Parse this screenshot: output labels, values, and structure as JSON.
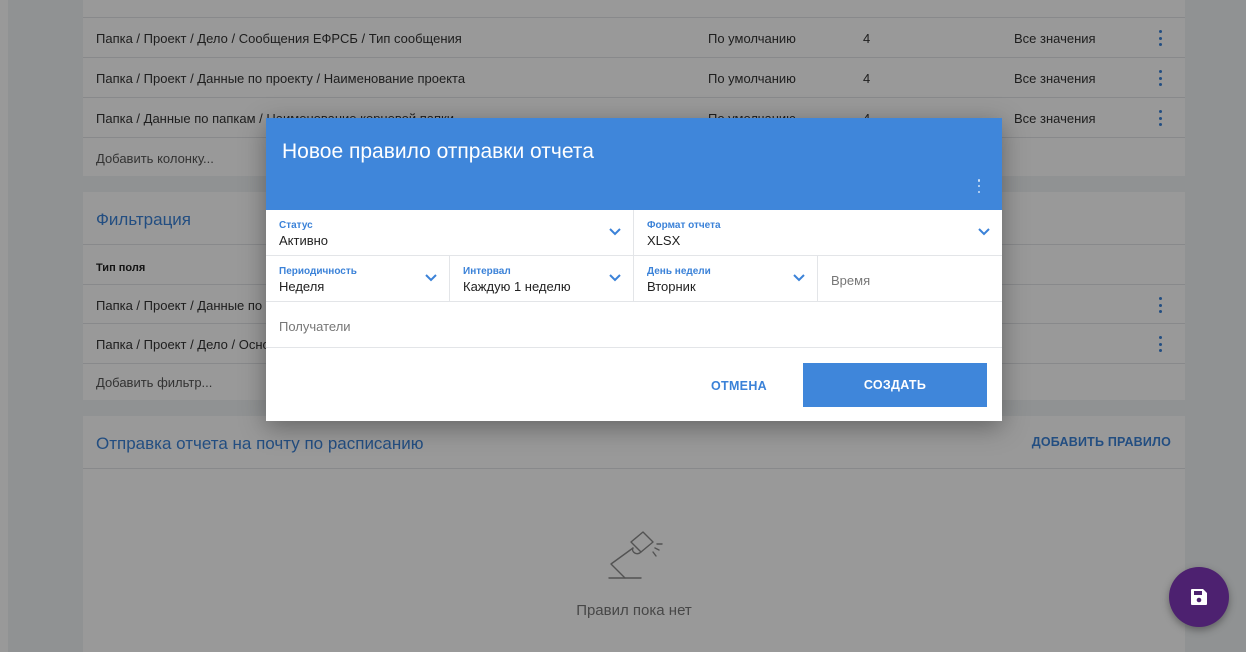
{
  "colors": {
    "accent": "#3f86da",
    "link": "#3b82d8",
    "fab": "#4d2170",
    "overlay": "rgba(0,0,0,0.4)"
  },
  "columns_table": {
    "rows": [
      {
        "path": "Папка / Проект / Дело / Сообщения ЕФРСБ / Тип сообщения",
        "sort": "По умолчанию",
        "width": "4",
        "values": "Все значения"
      },
      {
        "path": "Папка / Проект / Данные по проекту / Наименование проекта",
        "sort": "По умолчанию",
        "width": "4",
        "values": "Все значения"
      },
      {
        "path": "Папка / Данные по папкам / Наименование корневой папки",
        "sort": "По умолчанию",
        "width": "4",
        "values": "Все значения"
      }
    ],
    "add_column_label": "Добавить колонку..."
  },
  "filtering": {
    "title": "Фильтрация",
    "field_type_header": "Тип поля",
    "rows": [
      {
        "path": "Папка / Проект / Данные по"
      },
      {
        "path": "Папка / Проект / Дело / Осно"
      }
    ],
    "add_filter_label": "Добавить фильтр..."
  },
  "schedule": {
    "title": "Отправка отчета на почту по расписанию",
    "add_rule_label": "ДОБАВИТЬ ПРАВИЛО",
    "empty_icon": "desk-lamp-icon",
    "empty_text": "Правил пока нет"
  },
  "fab": {
    "icon": "save-icon"
  },
  "modal": {
    "title": "Новое правило отправки отчета",
    "fields": {
      "status": {
        "label": "Статус",
        "value": "Активно"
      },
      "format": {
        "label": "Формат отчета",
        "value": "XLSX"
      },
      "periodicity": {
        "label": "Периодичность",
        "value": "Неделя"
      },
      "interval": {
        "label": "Интервал",
        "value": "Каждую 1 неделю"
      },
      "weekday": {
        "label": "День недели",
        "value": "Вторник"
      },
      "time": {
        "placeholder": "Время"
      },
      "recipients": {
        "placeholder": "Получатели"
      }
    },
    "cancel_label": "ОТМЕНА",
    "create_label": "СОЗДАТЬ"
  }
}
